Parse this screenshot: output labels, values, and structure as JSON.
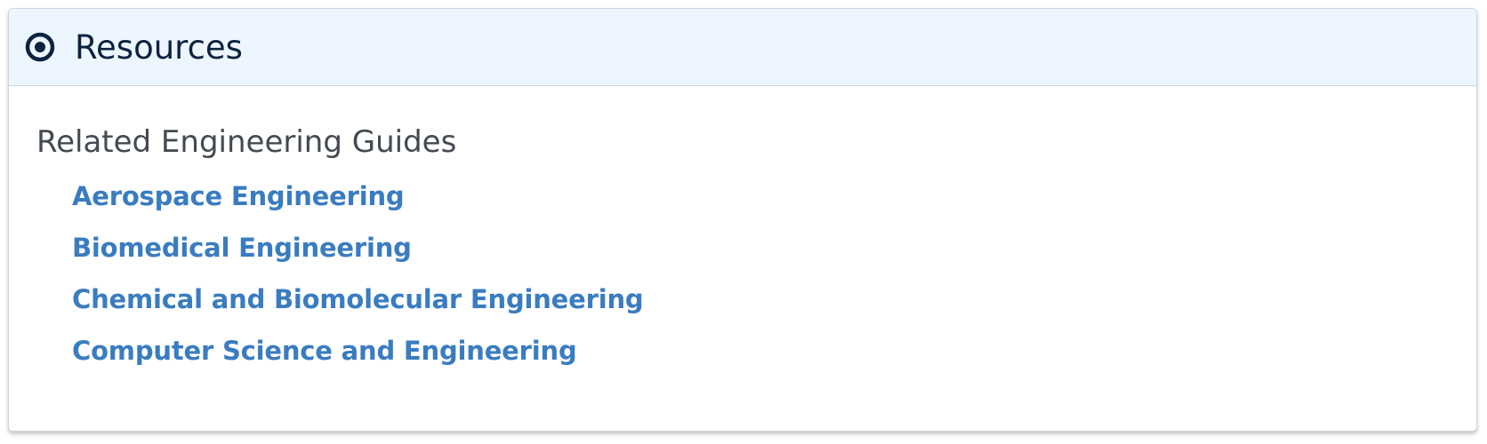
{
  "panel": {
    "title": "Resources",
    "icon": "target-circle-icon"
  },
  "section": {
    "heading": "Related Engineering Guides",
    "links": [
      {
        "label": "Aerospace Engineering"
      },
      {
        "label": "Biomedical Engineering"
      },
      {
        "label": "Chemical and Biomolecular Engineering"
      },
      {
        "label": "Computer Science and Engineering"
      }
    ]
  },
  "colors": {
    "header_bg": "#edf6ff",
    "title": "#0c2340",
    "link": "#3a7cc0",
    "heading": "#444a52"
  }
}
